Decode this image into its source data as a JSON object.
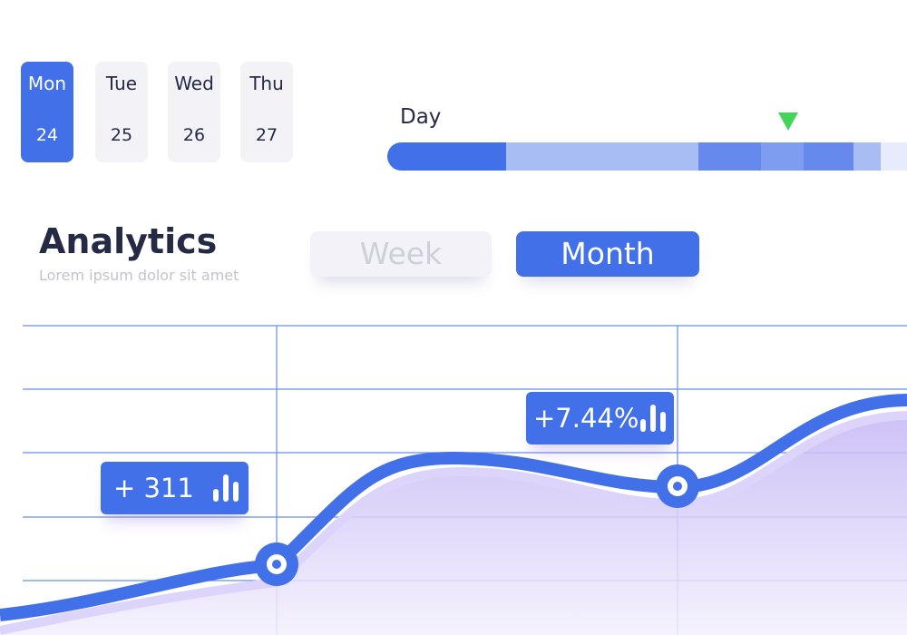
{
  "days": [
    {
      "name": "Mon",
      "date": "24",
      "selected": true
    },
    {
      "name": "Tue",
      "date": "25",
      "selected": false
    },
    {
      "name": "Wed",
      "date": "26",
      "selected": false
    },
    {
      "name": "Thu",
      "date": "27",
      "selected": false
    }
  ],
  "timeline": {
    "label": "Day",
    "marker_color": "#45d35a"
  },
  "analytics": {
    "title": "Analytics",
    "subtitle": "Lorem ipsum dolor sit amet"
  },
  "tabs": {
    "week": "Week",
    "month": "Month",
    "selected": "Month"
  },
  "badges": {
    "left": "+ 311",
    "right": "+7.44%"
  },
  "icons": {
    "badge_icon": "bar-chart-icon",
    "point_icon": "ring-marker-icon"
  },
  "colors": {
    "accent": "#4270e8",
    "area": "#c9bdf5",
    "grid": "#6b8de8"
  }
}
